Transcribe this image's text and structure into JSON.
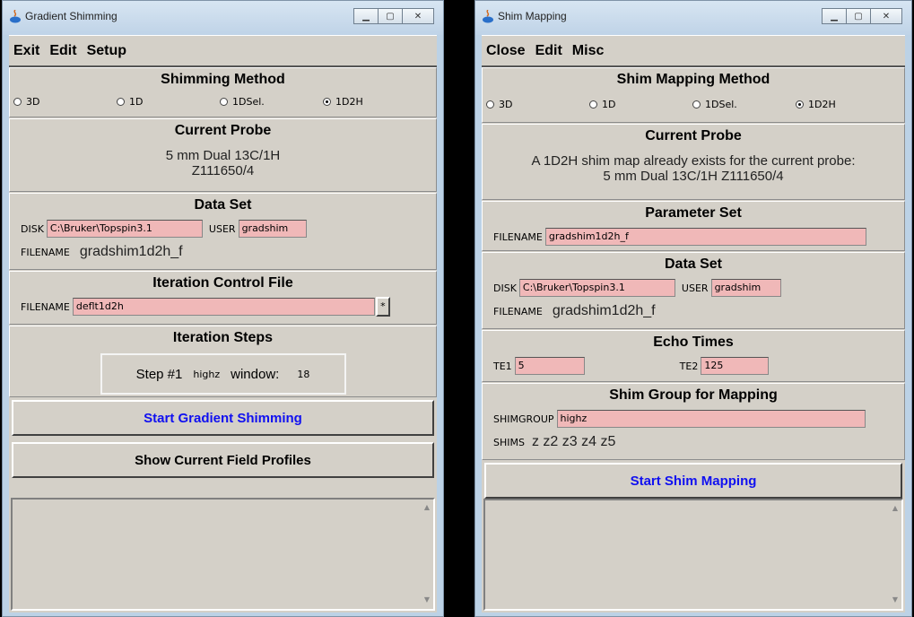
{
  "left_window": {
    "title": "Gradient Shimming",
    "menu": [
      "Exit",
      "Edit",
      "Setup"
    ],
    "shimming_method": {
      "title": "Shimming Method",
      "options": [
        "3D",
        "1D",
        "1DSel.",
        "1D2H"
      ],
      "selected": "1D2H"
    },
    "current_probe": {
      "title": "Current Probe",
      "line1": "5 mm Dual 13C/1H",
      "line2": "Z111650/4"
    },
    "data_set": {
      "title": "Data Set",
      "disk_label": "DISK",
      "disk_value": "C:\\Bruker\\Topspin3.1",
      "user_label": "USER",
      "user_value": "gradshim",
      "filename_label": "FILENAME",
      "filename_value": "gradshim1d2h_f"
    },
    "iteration_control": {
      "title": "Iteration Control File",
      "filename_label": "FILENAME",
      "filename_value": "deflt1d2h",
      "browse": "*"
    },
    "iteration_steps": {
      "title": "Iteration Steps",
      "step": "Step #1",
      "group": "highz",
      "window_label": "window:",
      "window_value": "18"
    },
    "start_button": "Start Gradient Shimming",
    "profiles_button": "Show Current Field Profiles"
  },
  "right_window": {
    "title": "Shim Mapping",
    "menu": [
      "Close",
      "Edit",
      "Misc"
    ],
    "method": {
      "title": "Shim Mapping Method",
      "options": [
        "3D",
        "1D",
        "1DSel.",
        "1D2H"
      ],
      "selected": "1D2H"
    },
    "current_probe": {
      "title": "Current Probe",
      "line1": "A 1D2H shim map already exists for the current probe:",
      "line2": "5 mm Dual 13C/1H Z111650/4"
    },
    "parameter_set": {
      "title": "Parameter Set",
      "filename_label": "FILENAME",
      "filename_value": "gradshim1d2h_f"
    },
    "data_set": {
      "title": "Data Set",
      "disk_label": "DISK",
      "disk_value": "C:\\Bruker\\Topspin3.1",
      "user_label": "USER",
      "user_value": "gradshim",
      "filename_label": "FILENAME",
      "filename_value": "gradshim1d2h_f"
    },
    "echo_times": {
      "title": "Echo Times",
      "te1_label": "TE1",
      "te1_value": "5",
      "te2_label": "TE2",
      "te2_value": "125"
    },
    "shim_group": {
      "title": "Shim Group for Mapping",
      "group_label": "SHIMGROUP",
      "group_value": "highz",
      "shims_label": "SHIMS",
      "shims_value": "z z2 z3 z4 z5"
    },
    "start_button": "Start Shim Mapping"
  },
  "colors": {
    "input_bg": "#f0b8b8",
    "button_blue": "#1010f0",
    "panel_bg": "#d4d0c8"
  }
}
